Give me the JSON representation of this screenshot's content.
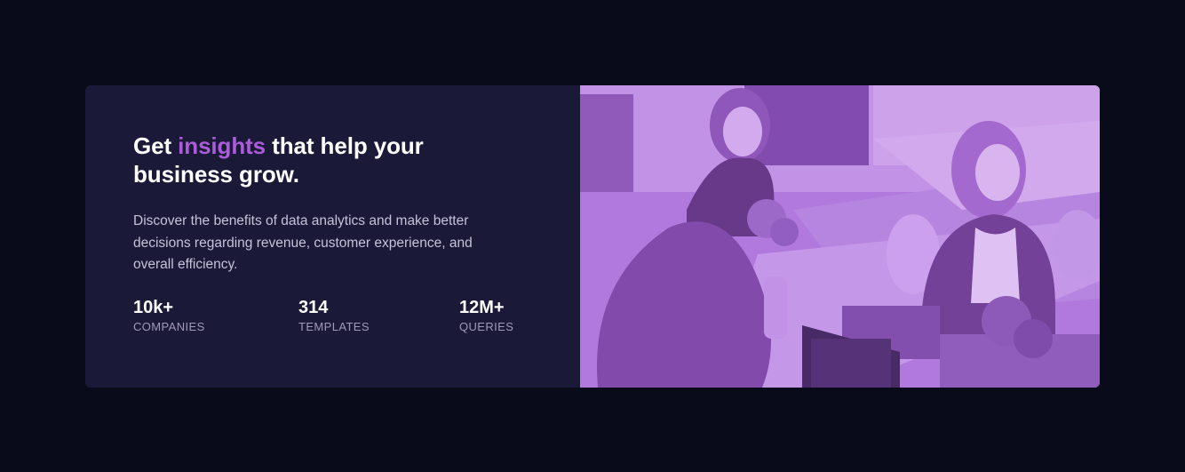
{
  "hero": {
    "headline_part1": "Get ",
    "headline_accent": "insights",
    "headline_part2": " that help your business grow.",
    "description": "Discover the benefits of data analytics and make better decisions regarding revenue, customer experience, and overall efficiency."
  },
  "stats": [
    {
      "value": "10k+",
      "label": "COMPANIES"
    },
    {
      "value": "314",
      "label": "TEMPLATES"
    },
    {
      "value": "12M+",
      "label": "QUERIES"
    }
  ],
  "colors": {
    "page_background": "#090b1a",
    "card_background": "#1b1938",
    "accent": "#ab5cdb",
    "image_tint": "#a95ed6",
    "label_text": "#9e9ab8"
  }
}
